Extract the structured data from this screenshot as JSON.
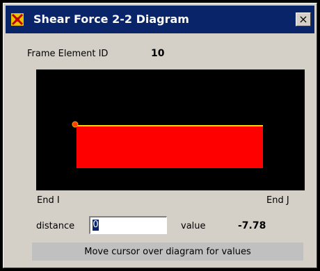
{
  "window": {
    "title": "Shear Force 2-2 Diagram",
    "close_glyph": "×",
    "app_icon": "app-logo-icon",
    "close_icon": "close-icon"
  },
  "element": {
    "label": "Frame Element ID",
    "id": "10"
  },
  "diagram": {
    "background_color": "#000000",
    "fill_color": "#ff0000",
    "outline_color": "#ffd700",
    "marker_color": "#ffa500",
    "end_i_label": "End I",
    "end_j_label": "End J"
  },
  "readout": {
    "distance_label": "distance",
    "distance_value": "0",
    "value_label": "value",
    "value": "-7.78"
  },
  "status": {
    "message": "Move cursor over diagram for values"
  },
  "colors": {
    "titlebar": "#0a246a",
    "dialog": "#d4d0c8",
    "status_bg": "#c0c0c0"
  }
}
